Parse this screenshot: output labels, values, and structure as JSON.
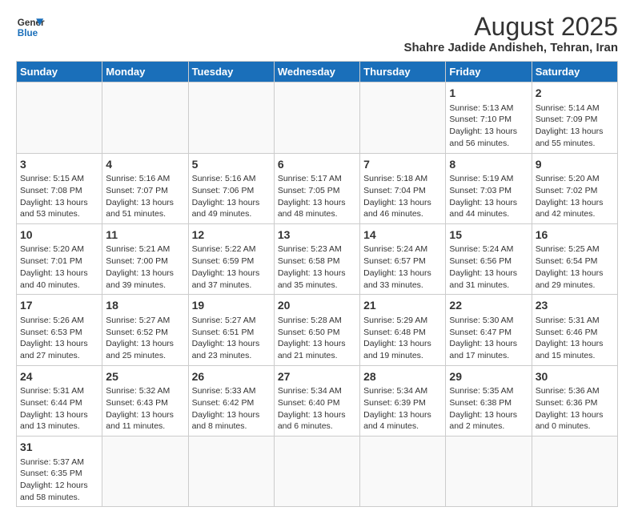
{
  "logo": {
    "line1": "General",
    "line2": "Blue"
  },
  "title": "August 2025",
  "subtitle": "Shahre Jadide Andisheh, Tehran, Iran",
  "days_of_week": [
    "Sunday",
    "Monday",
    "Tuesday",
    "Wednesday",
    "Thursday",
    "Friday",
    "Saturday"
  ],
  "weeks": [
    [
      {
        "day": "",
        "info": ""
      },
      {
        "day": "",
        "info": ""
      },
      {
        "day": "",
        "info": ""
      },
      {
        "day": "",
        "info": ""
      },
      {
        "day": "",
        "info": ""
      },
      {
        "day": "1",
        "info": "Sunrise: 5:13 AM\nSunset: 7:10 PM\nDaylight: 13 hours and 56 minutes."
      },
      {
        "day": "2",
        "info": "Sunrise: 5:14 AM\nSunset: 7:09 PM\nDaylight: 13 hours and 55 minutes."
      }
    ],
    [
      {
        "day": "3",
        "info": "Sunrise: 5:15 AM\nSunset: 7:08 PM\nDaylight: 13 hours and 53 minutes."
      },
      {
        "day": "4",
        "info": "Sunrise: 5:16 AM\nSunset: 7:07 PM\nDaylight: 13 hours and 51 minutes."
      },
      {
        "day": "5",
        "info": "Sunrise: 5:16 AM\nSunset: 7:06 PM\nDaylight: 13 hours and 49 minutes."
      },
      {
        "day": "6",
        "info": "Sunrise: 5:17 AM\nSunset: 7:05 PM\nDaylight: 13 hours and 48 minutes."
      },
      {
        "day": "7",
        "info": "Sunrise: 5:18 AM\nSunset: 7:04 PM\nDaylight: 13 hours and 46 minutes."
      },
      {
        "day": "8",
        "info": "Sunrise: 5:19 AM\nSunset: 7:03 PM\nDaylight: 13 hours and 44 minutes."
      },
      {
        "day": "9",
        "info": "Sunrise: 5:20 AM\nSunset: 7:02 PM\nDaylight: 13 hours and 42 minutes."
      }
    ],
    [
      {
        "day": "10",
        "info": "Sunrise: 5:20 AM\nSunset: 7:01 PM\nDaylight: 13 hours and 40 minutes."
      },
      {
        "day": "11",
        "info": "Sunrise: 5:21 AM\nSunset: 7:00 PM\nDaylight: 13 hours and 39 minutes."
      },
      {
        "day": "12",
        "info": "Sunrise: 5:22 AM\nSunset: 6:59 PM\nDaylight: 13 hours and 37 minutes."
      },
      {
        "day": "13",
        "info": "Sunrise: 5:23 AM\nSunset: 6:58 PM\nDaylight: 13 hours and 35 minutes."
      },
      {
        "day": "14",
        "info": "Sunrise: 5:24 AM\nSunset: 6:57 PM\nDaylight: 13 hours and 33 minutes."
      },
      {
        "day": "15",
        "info": "Sunrise: 5:24 AM\nSunset: 6:56 PM\nDaylight: 13 hours and 31 minutes."
      },
      {
        "day": "16",
        "info": "Sunrise: 5:25 AM\nSunset: 6:54 PM\nDaylight: 13 hours and 29 minutes."
      }
    ],
    [
      {
        "day": "17",
        "info": "Sunrise: 5:26 AM\nSunset: 6:53 PM\nDaylight: 13 hours and 27 minutes."
      },
      {
        "day": "18",
        "info": "Sunrise: 5:27 AM\nSunset: 6:52 PM\nDaylight: 13 hours and 25 minutes."
      },
      {
        "day": "19",
        "info": "Sunrise: 5:27 AM\nSunset: 6:51 PM\nDaylight: 13 hours and 23 minutes."
      },
      {
        "day": "20",
        "info": "Sunrise: 5:28 AM\nSunset: 6:50 PM\nDaylight: 13 hours and 21 minutes."
      },
      {
        "day": "21",
        "info": "Sunrise: 5:29 AM\nSunset: 6:48 PM\nDaylight: 13 hours and 19 minutes."
      },
      {
        "day": "22",
        "info": "Sunrise: 5:30 AM\nSunset: 6:47 PM\nDaylight: 13 hours and 17 minutes."
      },
      {
        "day": "23",
        "info": "Sunrise: 5:31 AM\nSunset: 6:46 PM\nDaylight: 13 hours and 15 minutes."
      }
    ],
    [
      {
        "day": "24",
        "info": "Sunrise: 5:31 AM\nSunset: 6:44 PM\nDaylight: 13 hours and 13 minutes."
      },
      {
        "day": "25",
        "info": "Sunrise: 5:32 AM\nSunset: 6:43 PM\nDaylight: 13 hours and 11 minutes."
      },
      {
        "day": "26",
        "info": "Sunrise: 5:33 AM\nSunset: 6:42 PM\nDaylight: 13 hours and 8 minutes."
      },
      {
        "day": "27",
        "info": "Sunrise: 5:34 AM\nSunset: 6:40 PM\nDaylight: 13 hours and 6 minutes."
      },
      {
        "day": "28",
        "info": "Sunrise: 5:34 AM\nSunset: 6:39 PM\nDaylight: 13 hours and 4 minutes."
      },
      {
        "day": "29",
        "info": "Sunrise: 5:35 AM\nSunset: 6:38 PM\nDaylight: 13 hours and 2 minutes."
      },
      {
        "day": "30",
        "info": "Sunrise: 5:36 AM\nSunset: 6:36 PM\nDaylight: 13 hours and 0 minutes."
      }
    ],
    [
      {
        "day": "31",
        "info": "Sunrise: 5:37 AM\nSunset: 6:35 PM\nDaylight: 12 hours and 58 minutes."
      },
      {
        "day": "",
        "info": ""
      },
      {
        "day": "",
        "info": ""
      },
      {
        "day": "",
        "info": ""
      },
      {
        "day": "",
        "info": ""
      },
      {
        "day": "",
        "info": ""
      },
      {
        "day": "",
        "info": ""
      }
    ]
  ]
}
